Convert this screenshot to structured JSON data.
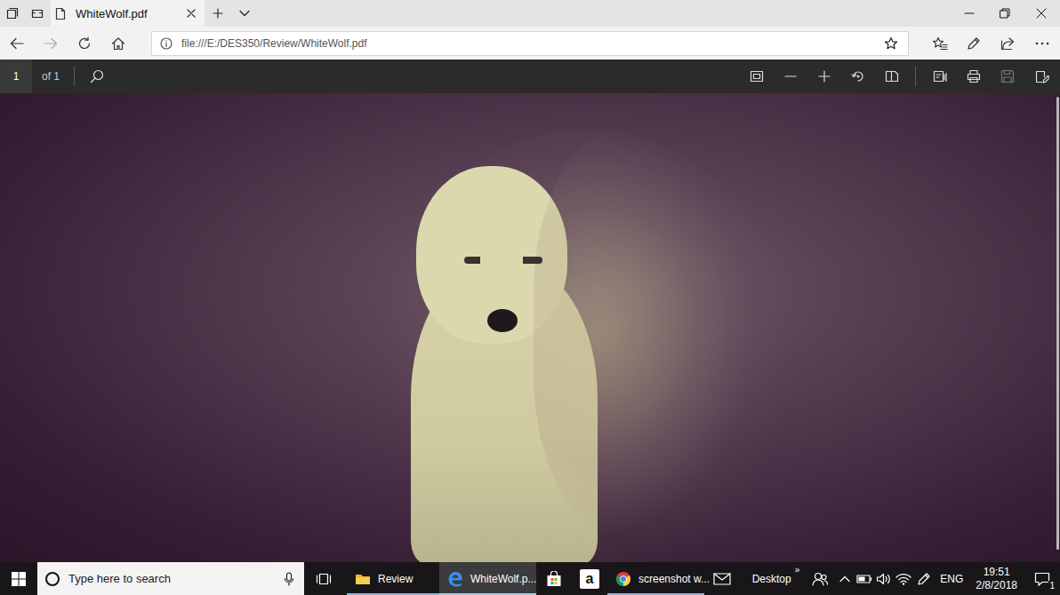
{
  "browser": {
    "tabs": [
      {
        "label": "WhiteWolf.pdf",
        "selected": true
      }
    ],
    "address_bar": {
      "url": "file:///E:/DES350/Review/WhiteWolf.pdf"
    }
  },
  "pdf_toolbar": {
    "page": "1",
    "page_count": "of 1"
  },
  "taskbar": {
    "search": {
      "placeholder": "Type here to search"
    },
    "apps": [
      {
        "kind": "folder",
        "label": "Review",
        "running": true,
        "selected": false
      },
      {
        "kind": "edge",
        "label": "WhiteWolf.p...",
        "running": true,
        "selected": true
      },
      {
        "kind": "store",
        "running": false,
        "selected": false
      },
      {
        "kind": "amazon",
        "glyph": "a",
        "running": false,
        "selected": false
      },
      {
        "kind": "chrome",
        "label": "screenshot w...",
        "running": true,
        "selected": false
      },
      {
        "kind": "mail",
        "running": false,
        "selected": false
      }
    ],
    "toolbar": {
      "label": "Desktop",
      "overflow": "»"
    },
    "tray": {
      "language": "ENG",
      "time": "19:51",
      "date": "2/8/2018",
      "notifications": "1"
    }
  }
}
